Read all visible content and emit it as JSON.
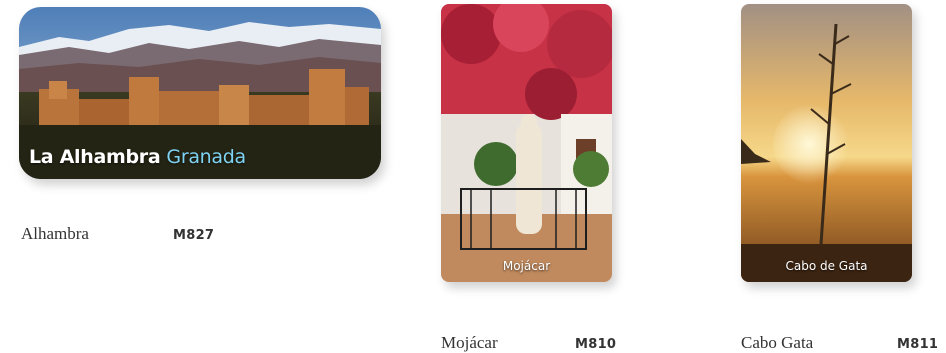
{
  "products": [
    {
      "name": "Alhambra",
      "code": "M827",
      "caption_bold": "La Alhambra",
      "caption_light": "Granada",
      "image": "alhambra-palace-sunset-photo"
    },
    {
      "name": "Mojácar",
      "code": "M810",
      "caption": "Mojácar",
      "image": "mojacar-statue-bougainvillea-photo"
    },
    {
      "name": "Cabo Gata",
      "code": "M811",
      "caption": "Cabo de Gata",
      "image": "cabo-de-gata-sunset-agave-photo"
    }
  ]
}
